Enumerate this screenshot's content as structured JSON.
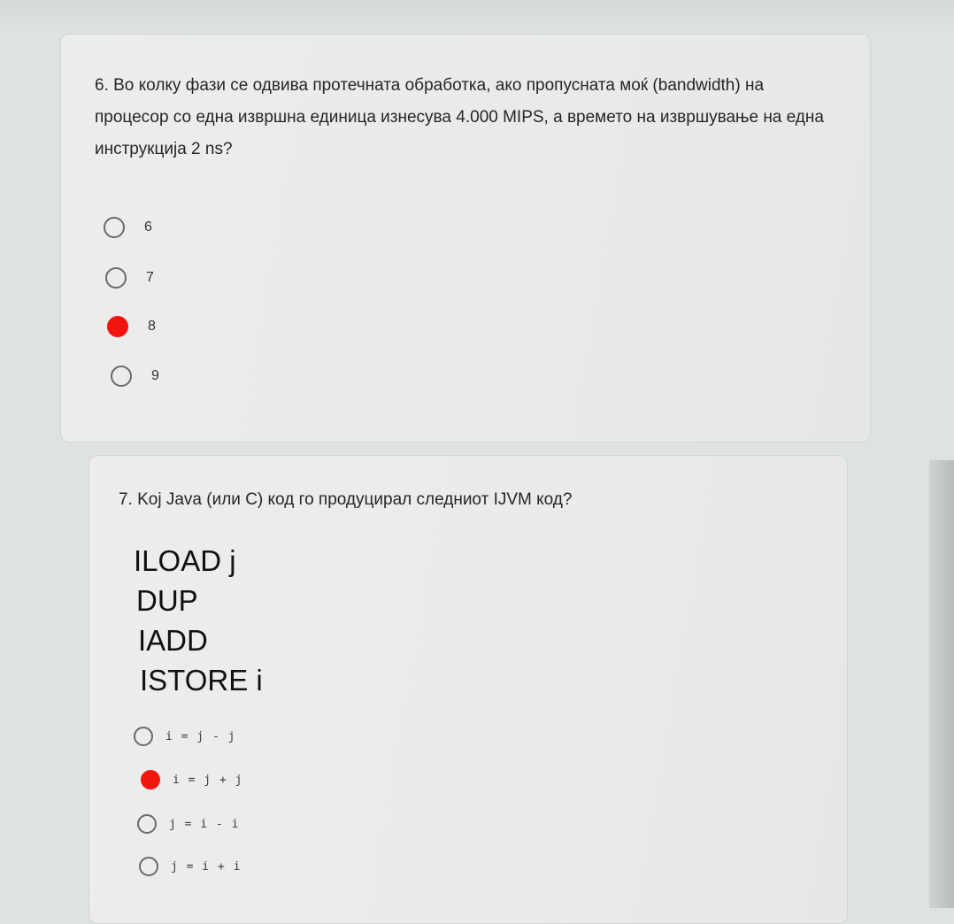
{
  "questions": [
    {
      "text": "6. Во колку фази се одвива протечната обработка, ако пропусната моќ (bandwidth) на процесор со една извршна единица изнесува 4.000 MIPS, а времето на извршување на една инструкција 2 ns?",
      "options": [
        "6",
        "7",
        "8",
        "9"
      ],
      "selected_option": "8"
    },
    {
      "text": "7. Koj Java (или C) код го продуцирал следниот IJVM код?",
      "code_lines": [
        "ILOAD j",
        "DUP",
        "IADD",
        "ISTORE i"
      ],
      "options": [
        "i = j - j",
        "i = j + j",
        "j = i - i",
        "j = i + i"
      ],
      "selected_option": "i = j + j"
    }
  ],
  "colors": {
    "selected_radio": "#f0160e",
    "unselected_radio_border": "#6a6a6a",
    "card_background": "#ebeceb",
    "page_background": "#dfe2e3"
  },
  "icons": {
    "unselected_option": "radio-empty-icon",
    "selected_option": "radio-filled-icon"
  }
}
